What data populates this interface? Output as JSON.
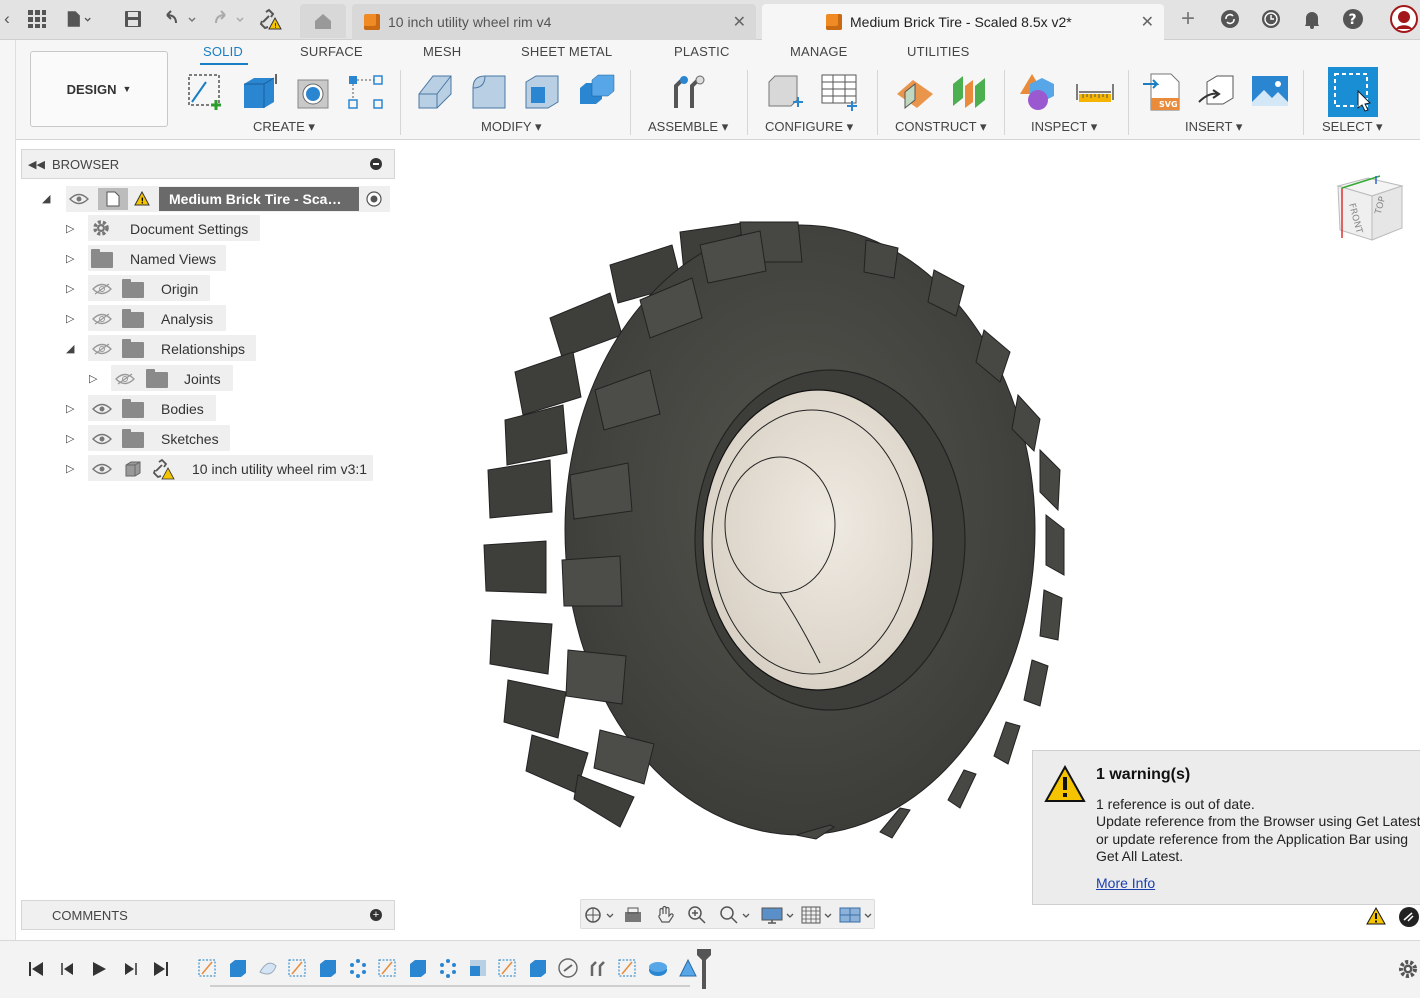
{
  "tabs": [
    {
      "label": "10 inch utility wheel rim v4",
      "active": false
    },
    {
      "label": "Medium Brick Tire - Scaled 8.5x v2*",
      "active": true
    }
  ],
  "ribbon": {
    "workspace": "DESIGN",
    "tabs": [
      "SOLID",
      "SURFACE",
      "MESH",
      "SHEET METAL",
      "PLASTIC",
      "MANAGE",
      "UTILITIES"
    ],
    "active_tab": "SOLID",
    "groups": [
      "CREATE",
      "MODIFY",
      "ASSEMBLE",
      "CONFIGURE",
      "CONSTRUCT",
      "INSPECT",
      "INSERT",
      "SELECT"
    ]
  },
  "browser": {
    "title": "BROWSER",
    "root": "Medium Brick Tire - Scaled 8.5x v2",
    "items": [
      {
        "label": "Document Settings",
        "icon": "gear-icon"
      },
      {
        "label": "Named Views",
        "icon": "folder-icon"
      },
      {
        "label": "Origin",
        "icon": "folder-icon",
        "hidden": true
      },
      {
        "label": "Analysis",
        "icon": "folder-icon",
        "hidden": true
      },
      {
        "label": "Relationships",
        "icon": "folder-icon",
        "hidden": true,
        "expanded": true
      },
      {
        "label": "Joints",
        "icon": "folder-icon",
        "hidden": true
      },
      {
        "label": "Bodies",
        "icon": "folder-icon"
      },
      {
        "label": "Sketches",
        "icon": "folder-icon"
      },
      {
        "label": "10 inch utility wheel rim v3:1",
        "icon": "component-icon"
      }
    ]
  },
  "comments": {
    "title": "COMMENTS"
  },
  "warning": {
    "title": "1 warning(s)",
    "lines": [
      "1 reference is out of date.",
      "Update reference from the Browser using Get Latest,",
      "or update reference from the Application Bar using",
      "Get All Latest."
    ],
    "link": "More Info"
  },
  "viewcube": {
    "front": "FRONT",
    "top": "TOP"
  },
  "colors": {
    "accent": "#1a7ec5",
    "tire": "#4a4a47",
    "rim": "#e6e0d6",
    "warning": "#f5c400"
  }
}
